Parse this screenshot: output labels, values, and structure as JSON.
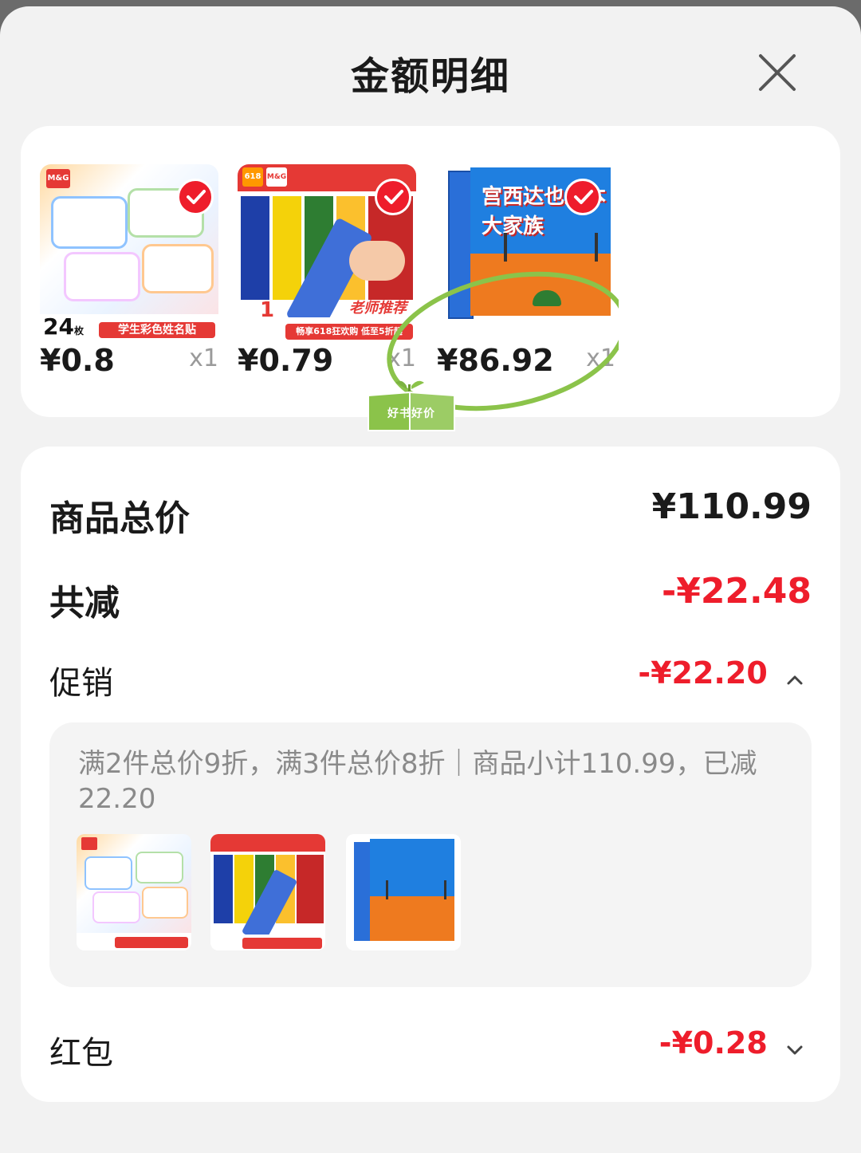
{
  "header": {
    "title": "金额明细",
    "close_icon": "close-icon"
  },
  "products": [
    {
      "name_label": "学生彩色姓名贴",
      "count_label": "24",
      "count_unit": "枚",
      "price": "¥0.8",
      "qty": "x1",
      "selected": true
    },
    {
      "name_label": "老师推荐",
      "promo_label": "畅享618狂欢购 低至5折起",
      "price": "¥0.79",
      "qty": "x1",
      "selected": true
    },
    {
      "name_label": "宫西达也绘本大家族",
      "price": "¥86.92",
      "qty": "x1",
      "selected": true,
      "badge": "好书好价"
    }
  ],
  "summary": {
    "total_label": "商品总价",
    "total_value": "¥110.99",
    "discount_label": "共减",
    "discount_value": "-¥22.48",
    "promo_label": "促销",
    "promo_value": "-¥22.20",
    "promo_detail": "满2件总价9折，满3件总价8折｜商品小计110.99，已减22.20",
    "redpacket_label": "红包",
    "redpacket_value": "-¥0.28"
  },
  "colors": {
    "accent_red": "#ee1d2b",
    "badge_green": "#8bc34a"
  }
}
